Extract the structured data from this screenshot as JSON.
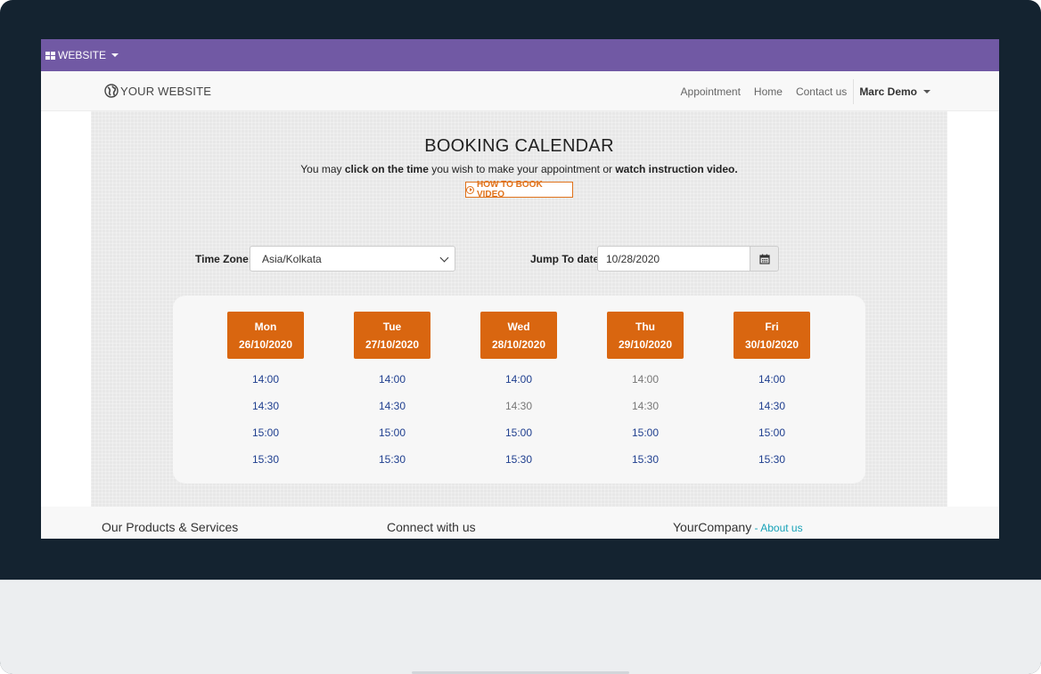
{
  "adminbar": {
    "label": "WEBSITE"
  },
  "navbar": {
    "brand": "YOUR WEBSITE",
    "links": [
      "Appointment",
      "Home",
      "Contact us"
    ],
    "user": "Marc Demo"
  },
  "booking": {
    "title": "BOOKING CALENDAR",
    "subtitle_pre": "You may ",
    "subtitle_bold1": "click on the time",
    "subtitle_mid": " you wish to make your appointment or ",
    "subtitle_bold2": "watch instruction video.",
    "video_button": "HOW TO BOOK VIDEO",
    "timezone_label": "Time Zone:",
    "timezone_value": "Asia/Kolkata",
    "jump_label": "Jump To date:",
    "jump_value": "10/28/2020"
  },
  "days": [
    {
      "day": "Mon",
      "date": "26/10/2020",
      "slots": [
        {
          "time": "14:00",
          "available": true
        },
        {
          "time": "14:30",
          "available": true
        },
        {
          "time": "15:00",
          "available": true
        },
        {
          "time": "15:30",
          "available": true
        }
      ]
    },
    {
      "day": "Tue",
      "date": "27/10/2020",
      "slots": [
        {
          "time": "14:00",
          "available": true
        },
        {
          "time": "14:30",
          "available": true
        },
        {
          "time": "15:00",
          "available": true
        },
        {
          "time": "15:30",
          "available": true
        }
      ]
    },
    {
      "day": "Wed",
      "date": "28/10/2020",
      "slots": [
        {
          "time": "14:00",
          "available": true
        },
        {
          "time": "14:30",
          "available": false
        },
        {
          "time": "15:00",
          "available": true
        },
        {
          "time": "15:30",
          "available": true
        }
      ]
    },
    {
      "day": "Thu",
      "date": "29/10/2020",
      "slots": [
        {
          "time": "14:00",
          "available": false
        },
        {
          "time": "14:30",
          "available": false
        },
        {
          "time": "15:00",
          "available": true
        },
        {
          "time": "15:30",
          "available": true
        }
      ]
    },
    {
      "day": "Fri",
      "date": "30/10/2020",
      "slots": [
        {
          "time": "14:00",
          "available": true
        },
        {
          "time": "14:30",
          "available": true
        },
        {
          "time": "15:00",
          "available": true
        },
        {
          "time": "15:30",
          "available": true
        }
      ]
    }
  ],
  "footer": {
    "col1": "Our Products & Services",
    "col2": "Connect with us",
    "col3": "YourCompany",
    "col3_sep": " - ",
    "col3_link": "About us"
  },
  "colors": {
    "adminbar": "#7159a4",
    "accent": "#d96610",
    "slot_available": "#1f3f8f",
    "link": "#17a2b8"
  }
}
